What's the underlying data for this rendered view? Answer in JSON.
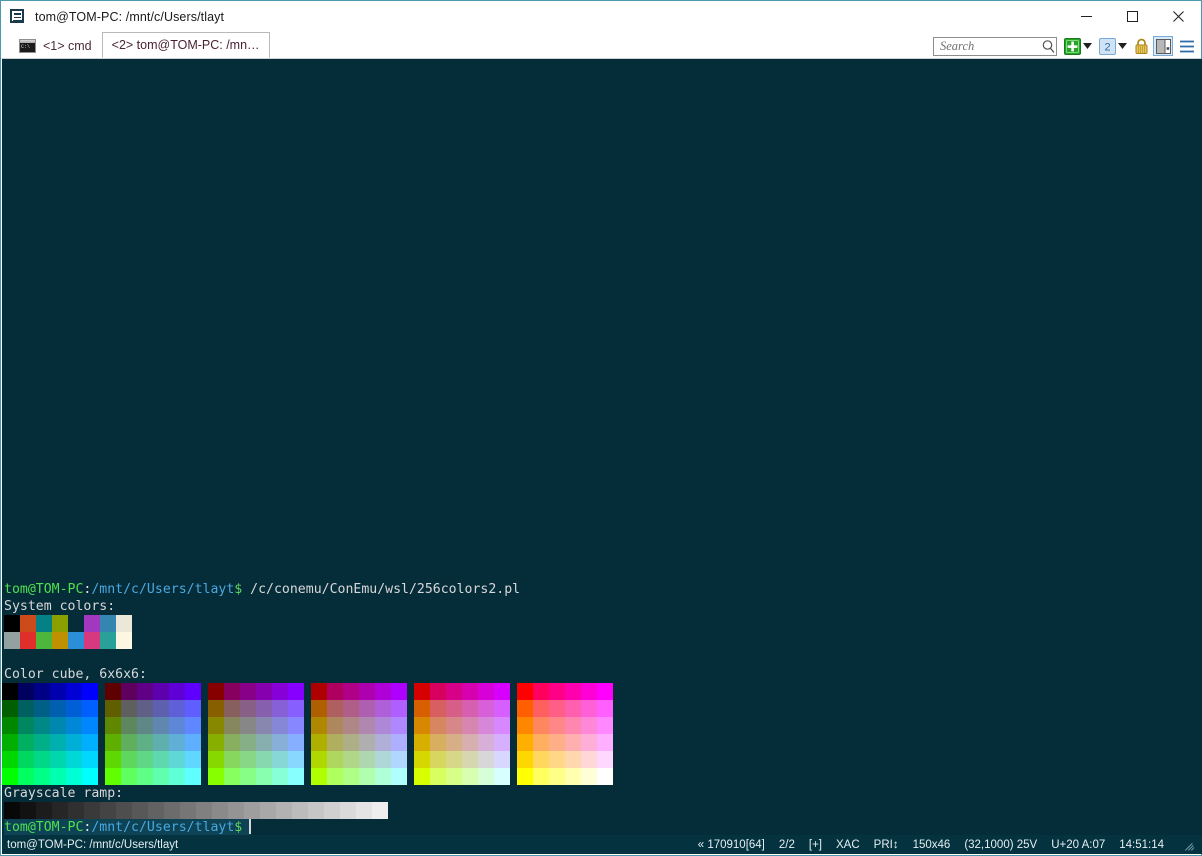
{
  "window": {
    "title": "tom@TOM-PC: /mnt/c/Users/tlayt",
    "icon": "conemu-icon",
    "minimize_label": "—",
    "maximize_label": "□",
    "close_label": "✕"
  },
  "tabs": [
    {
      "label": "<1> cmd",
      "active": false,
      "icon": "cmd-console-icon"
    },
    {
      "label": "<2> tom@TOM-PC: /mn…",
      "active": true,
      "icon": ""
    }
  ],
  "toolbar": {
    "search_placeholder": "Search",
    "search_value": "",
    "search_icon": "magnifier-icon",
    "new_console_label": "+",
    "new_console_icon": "green-plus-icon",
    "new_console_dropdown_icon": "chevron-down-icon",
    "active_console_count": "2",
    "console_list_icon": "console-count-icon",
    "console_list_dropdown_icon": "chevron-down-icon",
    "lock_icon": "lock-icon",
    "split_icon": "split-pane-icon",
    "menu_icon": "hamburger-menu-icon"
  },
  "terminal": {
    "background": "#042c39",
    "foreground": "#e8e8e8",
    "prompt": {
      "user_host": "tom@TOM-PC",
      "colon": ":",
      "path": "/mnt/c/Users/tlayt",
      "sigil": "$",
      "user_host_color": "#4fe04f",
      "path_color": "#4aa8e0",
      "sigil_color": "#5fd75f"
    },
    "command": " /c/conemu/ConEmu/wsl/256colors2.pl",
    "headings": {
      "system_colors": "System colors:",
      "color_cube": "Color cube, 6x6x6:",
      "grayscale": "Grayscale ramp:"
    },
    "system_colors": {
      "row1": [
        "#000000",
        "#cd4a1b",
        "#038184",
        "#8aa000",
        "#042c39",
        "#a238bd",
        "#3486b0",
        "#ece8d9"
      ],
      "row2": [
        "#93a1a1",
        "#e02e2a",
        "#4cb73a",
        "#bf9100",
        "#2b8fd8",
        "#d7397f",
        "#2aa198",
        "#fdf6e3"
      ]
    },
    "cube_levels": [
      0,
      95,
      135,
      175,
      215,
      255
    ],
    "grayscale_levels": [
      8,
      18,
      28,
      38,
      48,
      58,
      68,
      78,
      88,
      98,
      108,
      118,
      128,
      138,
      148,
      158,
      168,
      178,
      188,
      198,
      208,
      218,
      228,
      238
    ],
    "cursor": "block-cursor"
  },
  "statusbar": {
    "left_text": "tom@TOM-PC: /mnt/c/Users/tlayt",
    "items": [
      "« 170910[64]",
      "2/2",
      "[+]",
      "XAC",
      "PRI↕",
      "150x46",
      "(32,1000) 25V",
      "U+20 A:07",
      "14:51:14"
    ],
    "resize_grip_icon": "resize-grip-icon"
  }
}
